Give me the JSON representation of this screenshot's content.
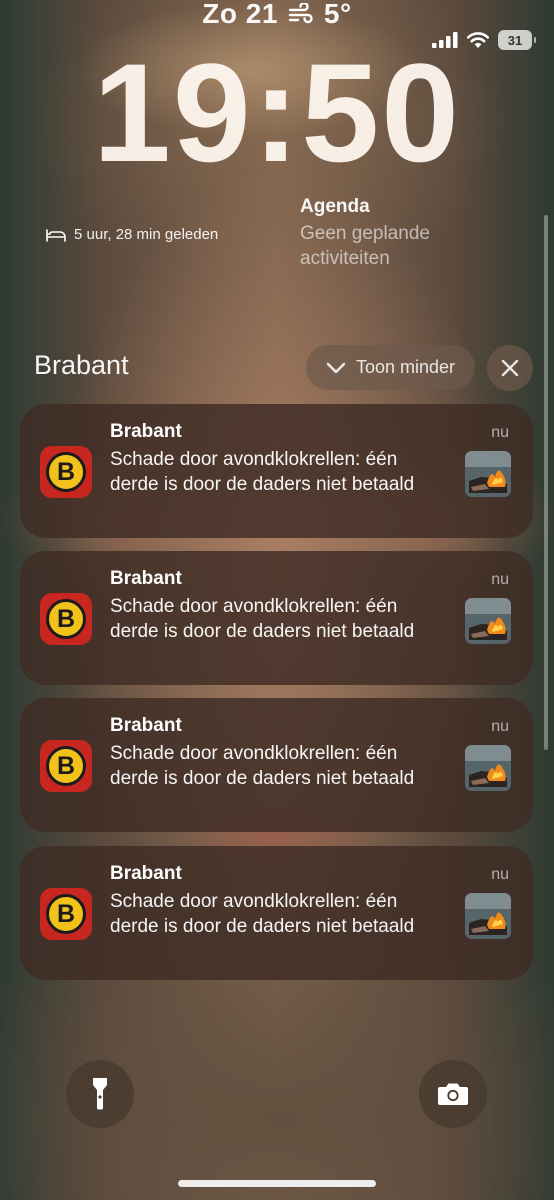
{
  "status_bar": {
    "day": "Zo 21",
    "temperature": "5°",
    "battery": "31",
    "time": "19:50"
  },
  "widgets": {
    "sleep": {
      "label": "5 uur, 28 min geleden",
      "icon": "bed-icon"
    },
    "agenda": {
      "title": "Agenda",
      "text": "Geen geplande activiteiten"
    }
  },
  "notification_group": {
    "title": "Brabant",
    "show_less_label": "Toon minder",
    "close_icon": "close-icon"
  },
  "notifications": [
    {
      "app": "Brabant",
      "time": "nu",
      "body": "Schade door avondklokrellen: één derde is door de daders niet betaald",
      "icon_letter": "B"
    },
    {
      "app": "Brabant",
      "time": "nu",
      "body": "Schade door avondklokrellen: één derde is door de daders niet betaald",
      "icon_letter": "B"
    },
    {
      "app": "Brabant",
      "time": "nu",
      "body": "Schade door avondklokrellen: één derde is door de daders niet betaald",
      "icon_letter": "B"
    },
    {
      "app": "Brabant",
      "time": "nu",
      "body": "Schade door avondklokrellen: één derde is door de daders niet betaald",
      "icon_letter": "B"
    }
  ],
  "colors": {
    "app_icon_bg": "#c8271f",
    "app_icon_ring": "#f2c21b"
  },
  "bottom_buttons": {
    "left_icon": "flashlight-icon",
    "right_icon": "camera-icon"
  }
}
